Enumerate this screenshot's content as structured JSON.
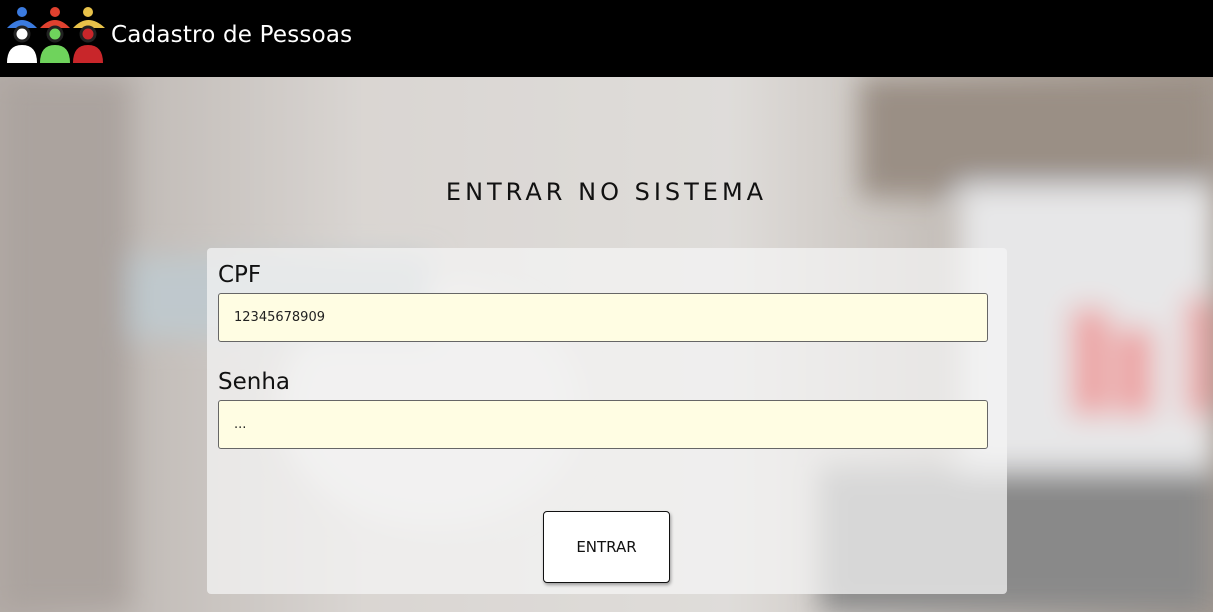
{
  "header": {
    "brand_title": "Cadastro de Pessoas",
    "logo_icon": "people-group-icon",
    "logo_colors": [
      "#3b7be0",
      "#e0412f",
      "#e8c24a",
      "#ffffff",
      "#6fd35c",
      "#c8262a"
    ]
  },
  "login": {
    "title": "ENTRAR NO SISTEMA",
    "cpf_label": "CPF",
    "cpf_value": "12345678909",
    "senha_label": "Senha",
    "senha_value": "...",
    "submit_label": "ENTRAR"
  },
  "colors": {
    "navbar": "#000000",
    "input_background": "#fffde3"
  }
}
